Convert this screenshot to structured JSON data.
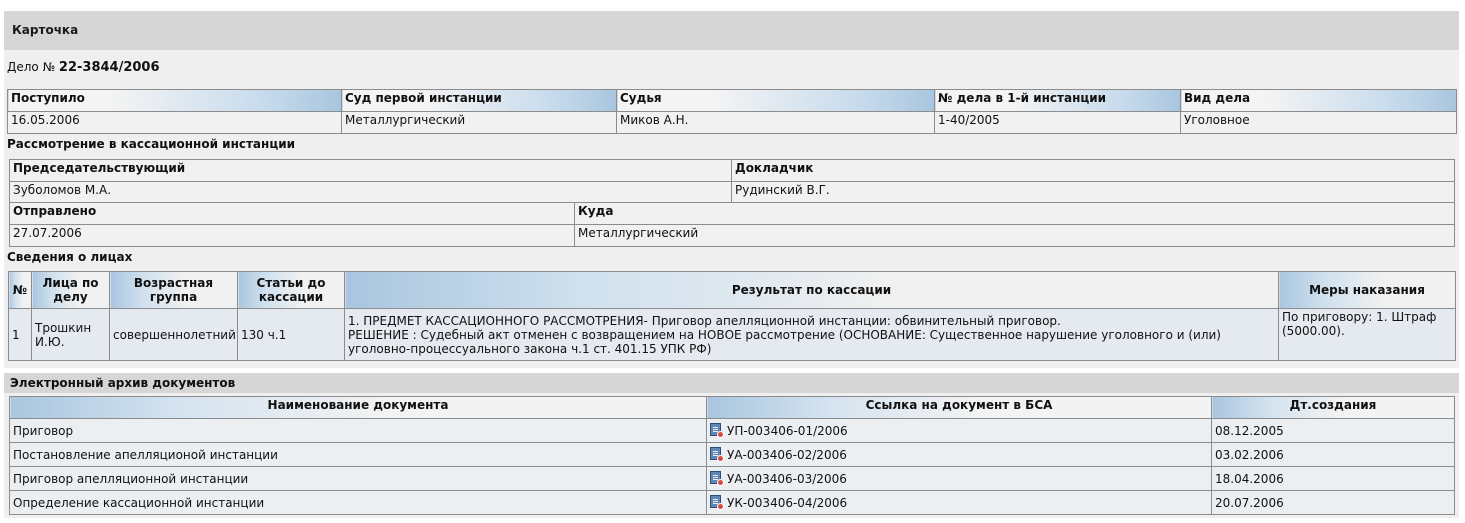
{
  "card": {
    "title": "Карточка",
    "case_prefix": "Дело №",
    "case_number": "22-3844/2006"
  },
  "main_table": {
    "headers": [
      "Поступило",
      "Суд первой инстанции",
      "Судья",
      "№ дела в 1-й инстанции",
      "Вид дела"
    ],
    "values": [
      "16.05.2006",
      "Металлургический",
      "Миков А.Н.",
      "1-40/2005",
      "Уголовное"
    ]
  },
  "cassation": {
    "title": "Рассмотрение в кассационной инстанции",
    "panel": {
      "headers": [
        "Председательствующий",
        "Докладчик"
      ],
      "values": [
        "Зуболомов М.А.",
        "Рудинский В.Г."
      ]
    },
    "sent": {
      "headers": [
        "Отправлено",
        "Куда"
      ],
      "values": [
        "27.07.2006",
        "Металлургический"
      ]
    }
  },
  "persons": {
    "title": "Сведения о лицах",
    "headers": [
      "№",
      "Лица по делу",
      "Возрастная группа",
      "Статьи до кассации",
      "Результат по кассации",
      "Меры наказания"
    ],
    "rows": [
      {
        "num": "1",
        "person": "Трошкин И.Ю.",
        "age_group": "совершеннолетний",
        "articles": "130 ч.1",
        "result_line1": "1. ПРЕДМЕТ КАССАЦИОННОГО РАССМОТРЕНИЯ- Приговор апелляционной инстанции: обвинительный приговор.",
        "result_line2": "РЕШЕНИЕ : Судебный акт отменен с возвращением на НОВОЕ рассмотрение (ОСНОВАНИЕ: Существенное нарушение уголовного и (или) уголовно-процессуального закона ч.1 ст. 401.15 УПК РФ)",
        "punishment": "По приговору: 1. Штраф (5000.00)."
      }
    ]
  },
  "archive": {
    "title": "Электронный архив документов",
    "headers": [
      "Наименование документа",
      "Ссылка на документ в БСА",
      "Дт.создания"
    ],
    "rows": [
      {
        "name": "Приговор",
        "link": "УП-003406-01/2006",
        "date": "08.12.2005",
        "icon": "document-icon"
      },
      {
        "name": "Постановление апелляционой инстанции",
        "link": "УА-003406-02/2006",
        "date": "03.02.2006",
        "icon": "document-icon"
      },
      {
        "name": "Приговор апелляционной инстанции",
        "link": "УА-003406-03/2006",
        "date": "18.04.2006",
        "icon": "document-icon"
      },
      {
        "name": "Определение кассационной инстанции",
        "link": "УК-003406-04/2006",
        "date": "20.07.2006",
        "icon": "document-icon"
      }
    ]
  }
}
